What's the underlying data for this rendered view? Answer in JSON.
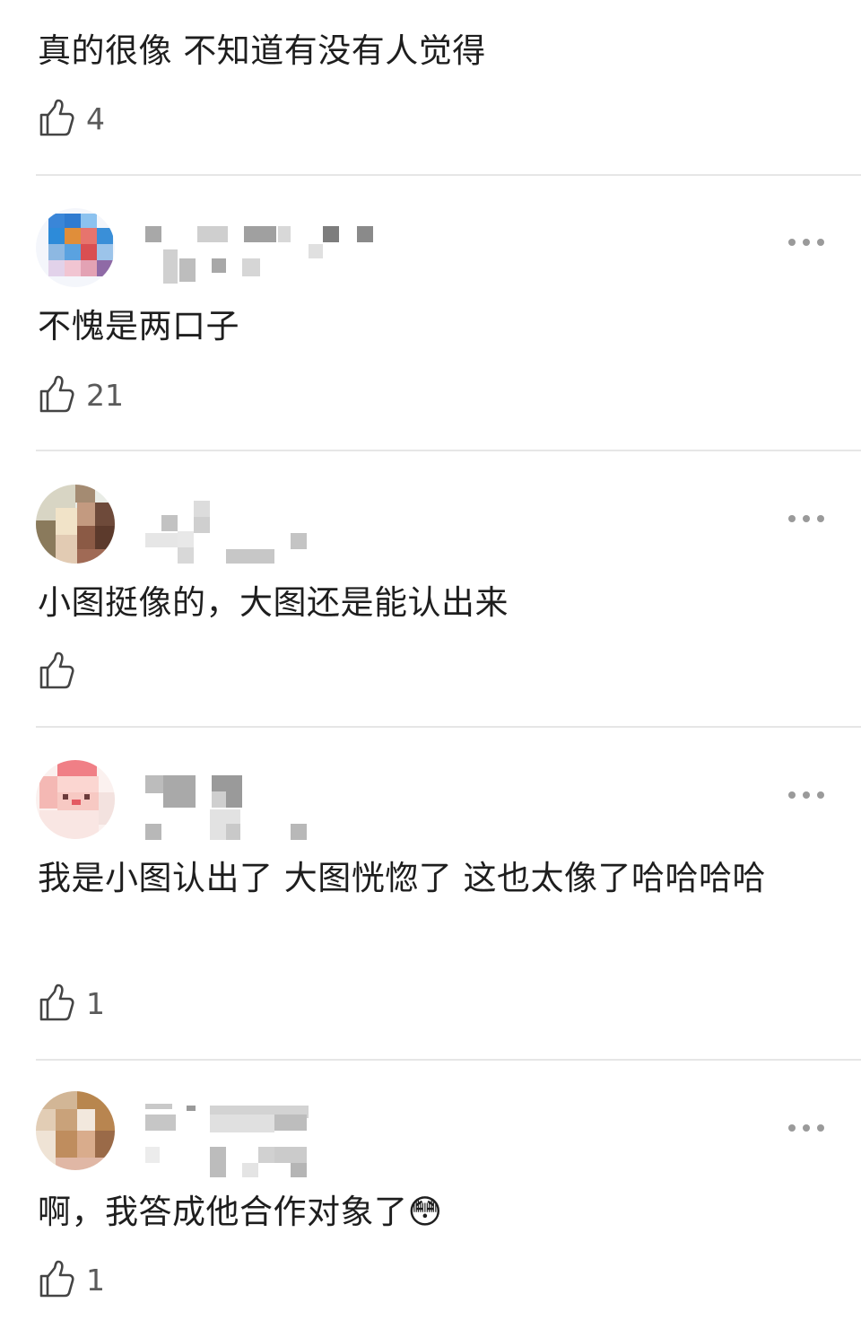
{
  "comments": [
    {
      "text": "真的很像 不知道有没有人觉得",
      "likes": "4"
    },
    {
      "text": "不愧是两口子",
      "likes": "21"
    },
    {
      "text": "小图挺像的，大图还是能认出来",
      "likes": ""
    },
    {
      "text": "我是小图认出了 大图恍惚了 这也太像了哈哈哈哈",
      "likes": "1"
    },
    {
      "text": "啊，我答成他合作对象了😳",
      "likes": "1"
    }
  ],
  "icons": {
    "like": "thumbs-up-icon",
    "more": "more-dots-icon"
  }
}
